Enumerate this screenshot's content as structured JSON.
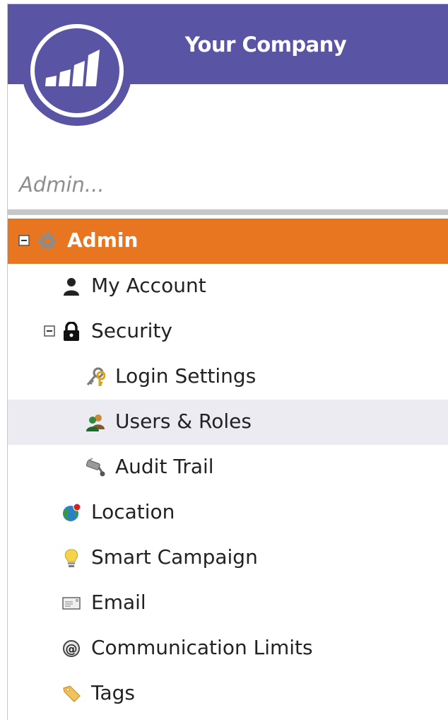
{
  "header": {
    "company_name": "Your Company",
    "background_color": "#5a54a4",
    "logo_icon": "marketo-logo-icon"
  },
  "search": {
    "placeholder": "Admin..."
  },
  "tree": {
    "selected_color": "#e8751f",
    "hover_color": "#ebebf1",
    "items": [
      {
        "label": "Admin",
        "icon": "gear-icon",
        "toggle": "collapse",
        "selected": true
      },
      {
        "label": "My Account",
        "icon": "person-icon"
      },
      {
        "label": "Security",
        "icon": "lock-icon",
        "toggle": "collapse"
      },
      {
        "label": "Login Settings",
        "icon": "keys-icon"
      },
      {
        "label": "Users & Roles",
        "icon": "users-icon",
        "highlighted": true
      },
      {
        "label": "Audit Trail",
        "icon": "camera-icon"
      },
      {
        "label": "Location",
        "icon": "globe-icon"
      },
      {
        "label": "Smart Campaign",
        "icon": "lightbulb-icon"
      },
      {
        "label": "Email",
        "icon": "envelope-icon"
      },
      {
        "label": "Communication Limits",
        "icon": "at-sign-icon"
      },
      {
        "label": "Tags",
        "icon": "tag-icon"
      }
    ]
  }
}
